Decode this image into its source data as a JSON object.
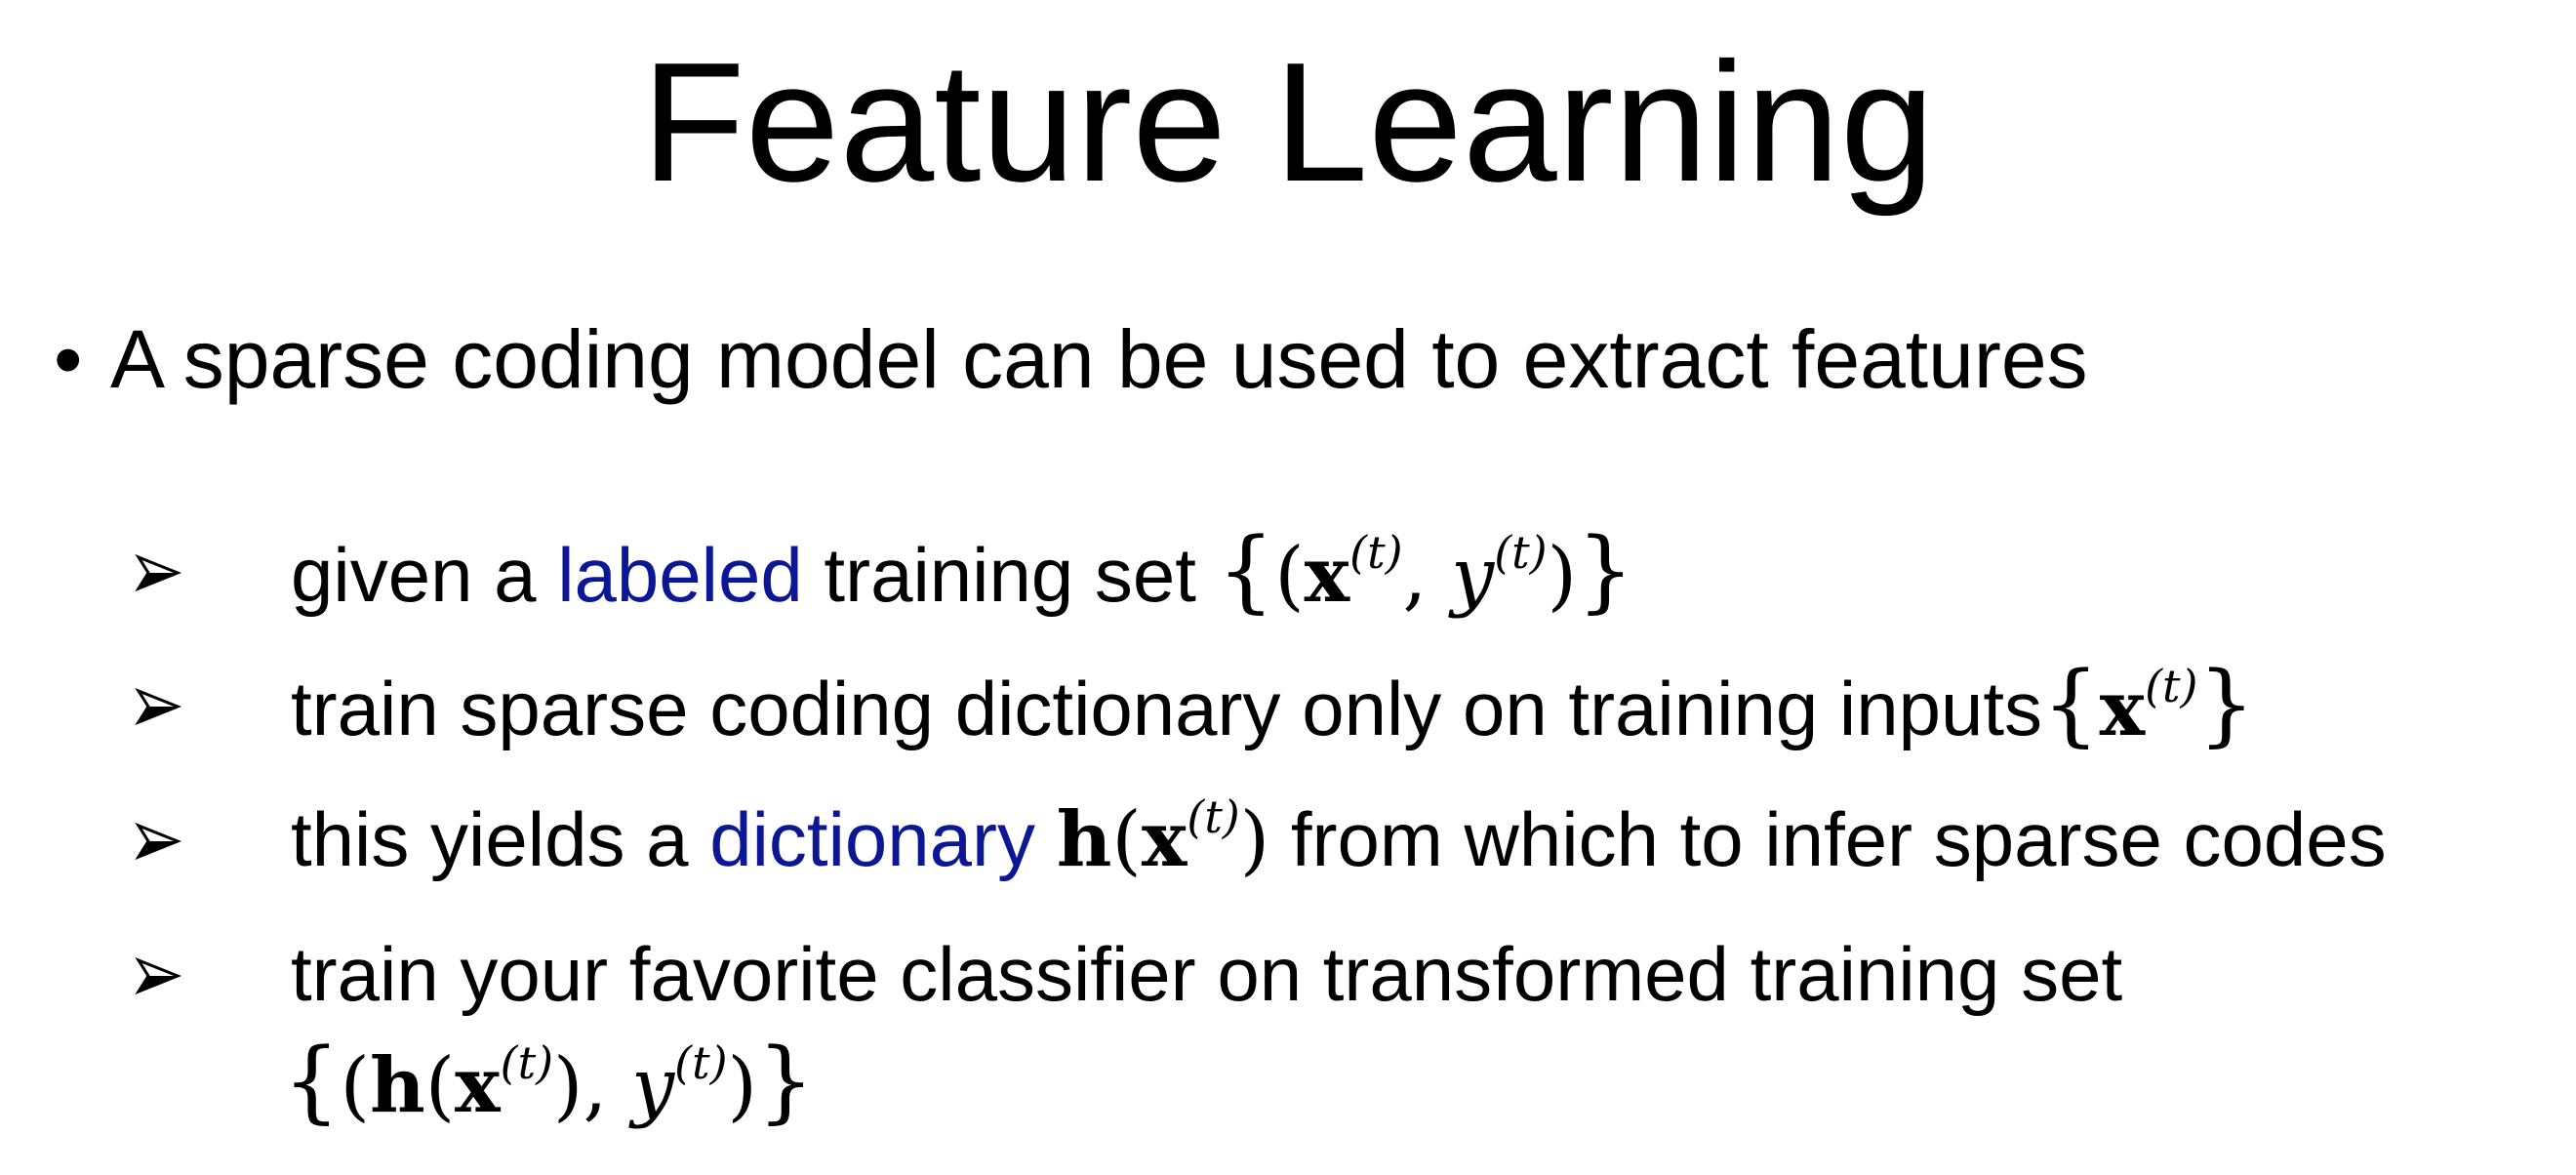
{
  "slide": {
    "title": "Feature Learning",
    "main_bullet": {
      "symbol": "•",
      "text": "A sparse coding model can be used to extract features"
    },
    "sub_bullets": [
      {
        "pre": "given a ",
        "highlight": "labeled",
        "post": " training set ",
        "math": "{(x(t), y(t))}"
      },
      {
        "pre": "train sparse coding dictionary only on training inputs",
        "math": "{x(t)}"
      },
      {
        "pre": "this yields a ",
        "highlight": "dictionary",
        "math": "h(x(t))",
        "post": " from which to infer sparse codes"
      },
      {
        "pre": "train your favorite classifier on transformed training set",
        "math": "{(h(x(t)), y(t))}"
      }
    ],
    "math_symbols": {
      "x": "x",
      "y": "y",
      "h": "h",
      "t": "(t)",
      "lbrace": "{",
      "rbrace": "}",
      "lparen": "(",
      "rparen": ")",
      "comma": ","
    },
    "colors": {
      "highlight": "#0b1794",
      "text": "#000000",
      "background": "#ffffff"
    },
    "icons": {
      "sub_bullet": "arrowhead-bullet-icon"
    }
  }
}
